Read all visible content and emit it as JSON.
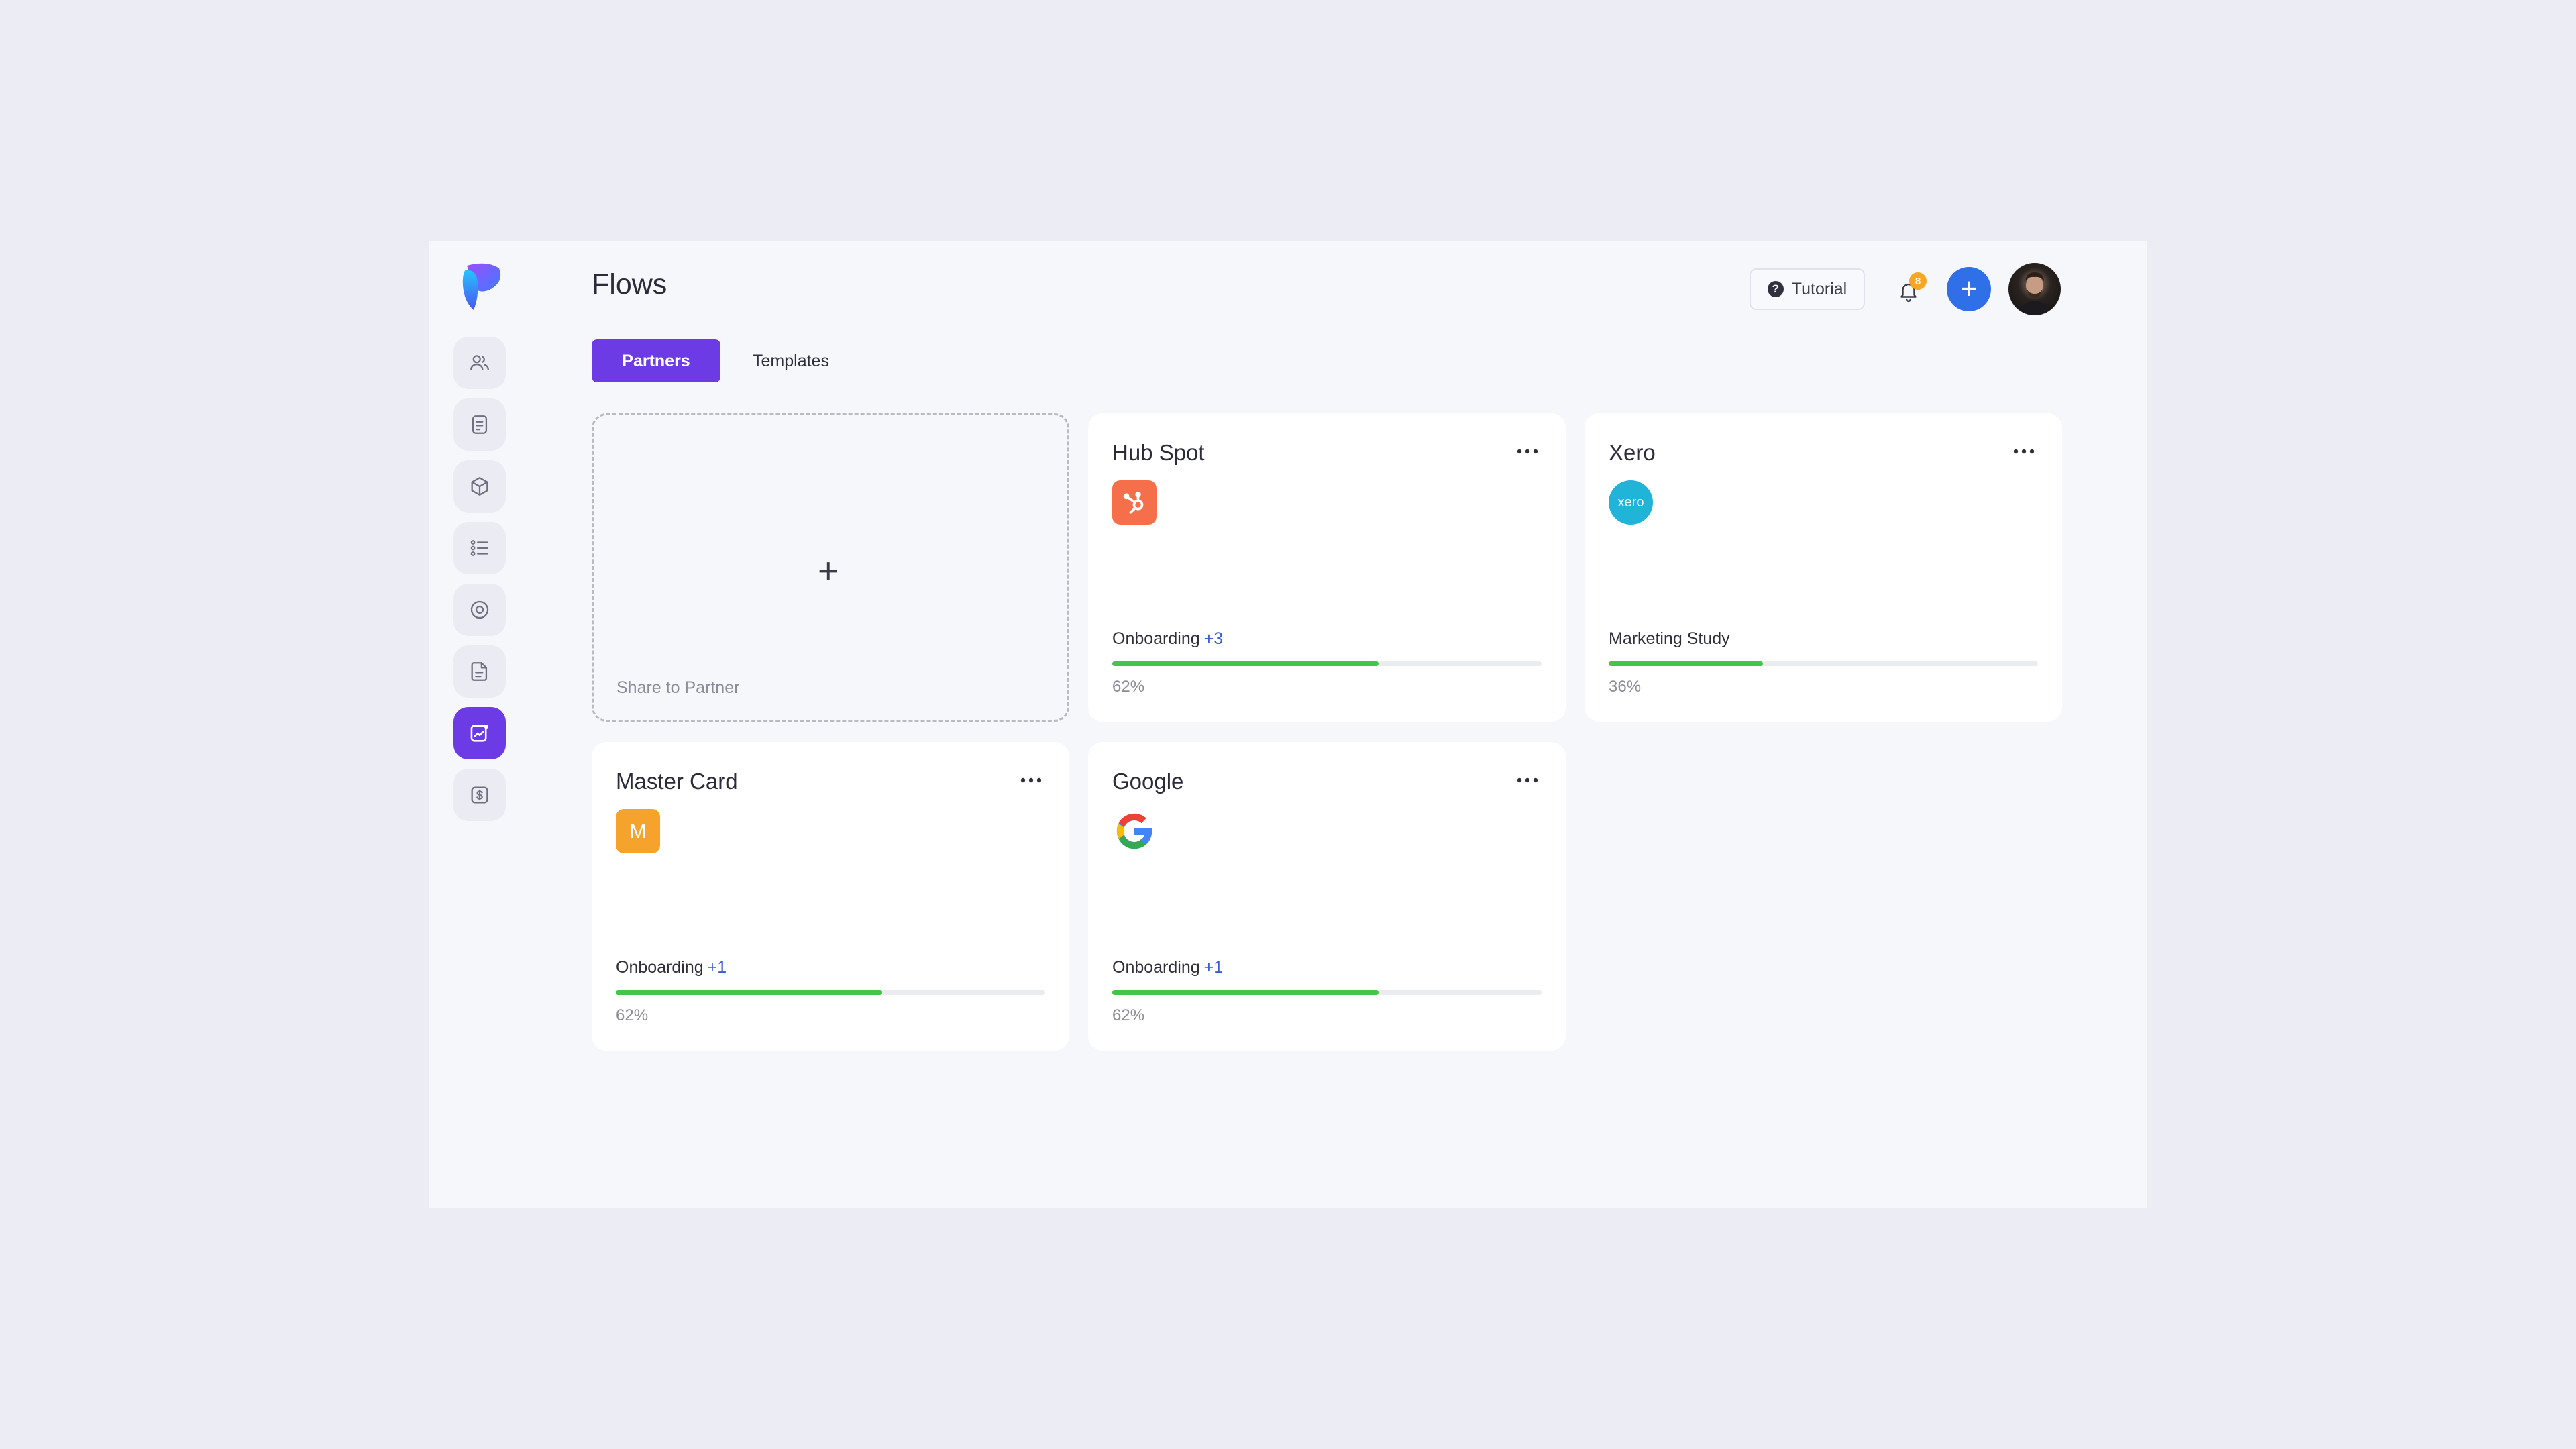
{
  "page": {
    "title": "Flows"
  },
  "sidebar": {
    "items": [
      {
        "icon": "users-icon"
      },
      {
        "icon": "document-icon"
      },
      {
        "icon": "cube-icon"
      },
      {
        "icon": "list-icon"
      },
      {
        "icon": "target-icon"
      },
      {
        "icon": "file-icon"
      },
      {
        "icon": "analytics-icon",
        "active": true
      },
      {
        "icon": "dollar-icon"
      }
    ]
  },
  "header": {
    "tutorial_label": "Tutorial",
    "notification_count": "8",
    "add_label": "+"
  },
  "tabs": [
    {
      "label": "Partners",
      "active": true
    },
    {
      "label": "Templates",
      "active": false
    }
  ],
  "add_card": {
    "icon": "+",
    "label": "Share to Partner"
  },
  "cards": [
    {
      "name": "Hub Spot",
      "logo": "hubspot-icon",
      "status": "Onboarding",
      "extra": "+3",
      "percent": 62,
      "percent_label": "62%"
    },
    {
      "name": "Xero",
      "logo": "xero-icon",
      "logo_text": "xero",
      "status": "Marketing Study",
      "extra": "",
      "percent": 36,
      "percent_label": "36%"
    },
    {
      "name": "Master Card",
      "logo": "mastercard-icon",
      "logo_text": "M",
      "status": "Onboarding",
      "extra": "+1",
      "percent": 62,
      "percent_label": "62%"
    },
    {
      "name": "Google",
      "logo": "google-icon",
      "status": "Onboarding",
      "extra": "+1",
      "percent": 62,
      "percent_label": "62%"
    }
  ],
  "colors": {
    "accent": "#6c3be6",
    "primary_blue": "#2f6fe8",
    "progress": "#45c44a",
    "hubspot": "#f5704a",
    "xero": "#1fb4d8",
    "mastercard": "#f5a32c"
  }
}
